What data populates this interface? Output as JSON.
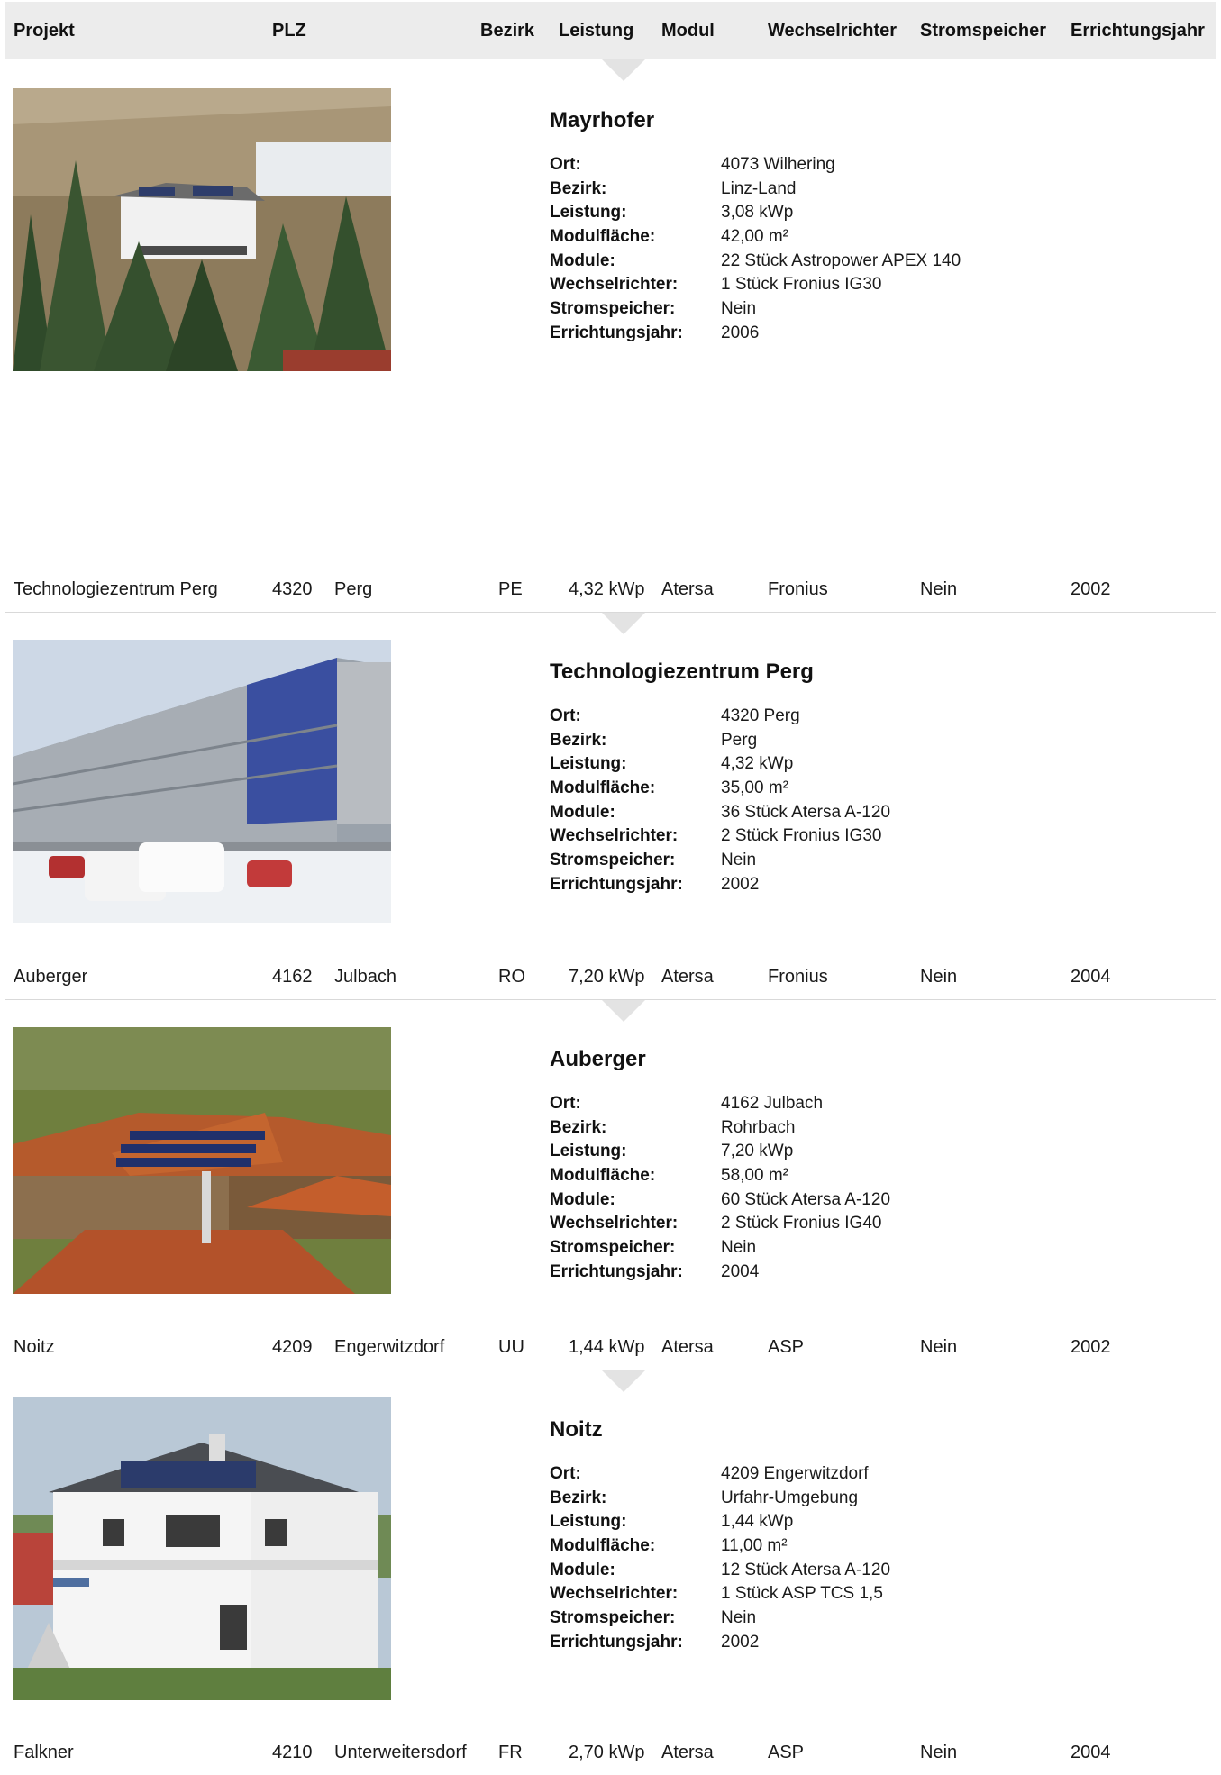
{
  "table": {
    "headers": {
      "projekt": "Projekt",
      "plz": "PLZ",
      "bezirk": "Bezirk",
      "leistung": "Leistung",
      "modul": "Modul",
      "wechselrichter": "Wechselrichter",
      "stromspeicher": "Stromspeicher",
      "jahr": "Errichtungsjahr"
    }
  },
  "labels": {
    "ort": "Ort:",
    "bezirk": "Bezirk:",
    "leistung": "Leistung:",
    "modulflaeche": "Modulfläche:",
    "module": "Module:",
    "wechselrichter": "Wechselrichter:",
    "stromspeicher": "Stromspeicher:",
    "jahr": "Errichtungsjahr:"
  },
  "detail0": {
    "title": "Mayrhofer",
    "ort": "4073 Wilhering",
    "bezirk": "Linz-Land",
    "leistung": "3,08 kWp",
    "modulflaeche": "42,00 m²",
    "module": "22 Stück Astropower APEX 140",
    "wechselrichter": "1 Stück Fronius IG30",
    "stromspeicher": "Nein",
    "jahr": "2006"
  },
  "rows": [
    {
      "projekt": "Technologiezentrum Perg",
      "plz": "4320",
      "ort": "Perg",
      "bezirk": "PE",
      "leistung": "4,32 kWp",
      "modul": "Atersa",
      "wechselrichter": "Fronius",
      "stromspeicher": "Nein",
      "jahr": "2002"
    },
    {
      "projekt": "Auberger",
      "plz": "4162",
      "ort": "Julbach",
      "bezirk": "RO",
      "leistung": "7,20 kWp",
      "modul": "Atersa",
      "wechselrichter": "Fronius",
      "stromspeicher": "Nein",
      "jahr": "2004"
    },
    {
      "projekt": "Noitz",
      "plz": "4209",
      "ort": "Engerwitzdorf",
      "bezirk": "UU",
      "leistung": "1,44 kWp",
      "modul": "Atersa",
      "wechselrichter": "ASP",
      "stromspeicher": "Nein",
      "jahr": "2002"
    },
    {
      "projekt": "Falkner",
      "plz": "4210",
      "ort": "Unterweitersdorf",
      "bezirk": "FR",
      "leistung": "2,70 kWp",
      "modul": "Atersa",
      "wechselrichter": "ASP",
      "stromspeicher": "Nein",
      "jahr": "2004"
    }
  ],
  "details": [
    {
      "title": "Technologiezentrum Perg",
      "ort": "4320 Perg",
      "bezirk": "Perg",
      "leistung": "4,32 kWp",
      "modulflaeche": "35,00 m²",
      "module": "36 Stück Atersa A-120",
      "wechselrichter": "2 Stück Fronius IG30",
      "stromspeicher": "Nein",
      "jahr": "2002"
    },
    {
      "title": "Auberger",
      "ort": "4162 Julbach",
      "bezirk": "Rohrbach",
      "leistung": "7,20 kWp",
      "modulflaeche": "58,00 m²",
      "module": "60 Stück Atersa A-120",
      "wechselrichter": "2 Stück Fronius IG40",
      "stromspeicher": "Nein",
      "jahr": "2004"
    },
    {
      "title": "Noitz",
      "ort": "4209 Engerwitzdorf",
      "bezirk": "Urfahr-Umgebung",
      "leistung": "1,44 kWp",
      "modulflaeche": "11,00 m²",
      "module": "12 Stück Atersa A-120",
      "wechselrichter": "1 Stück ASP TCS 1,5",
      "stromspeicher": "Nein",
      "jahr": "2002"
    }
  ]
}
